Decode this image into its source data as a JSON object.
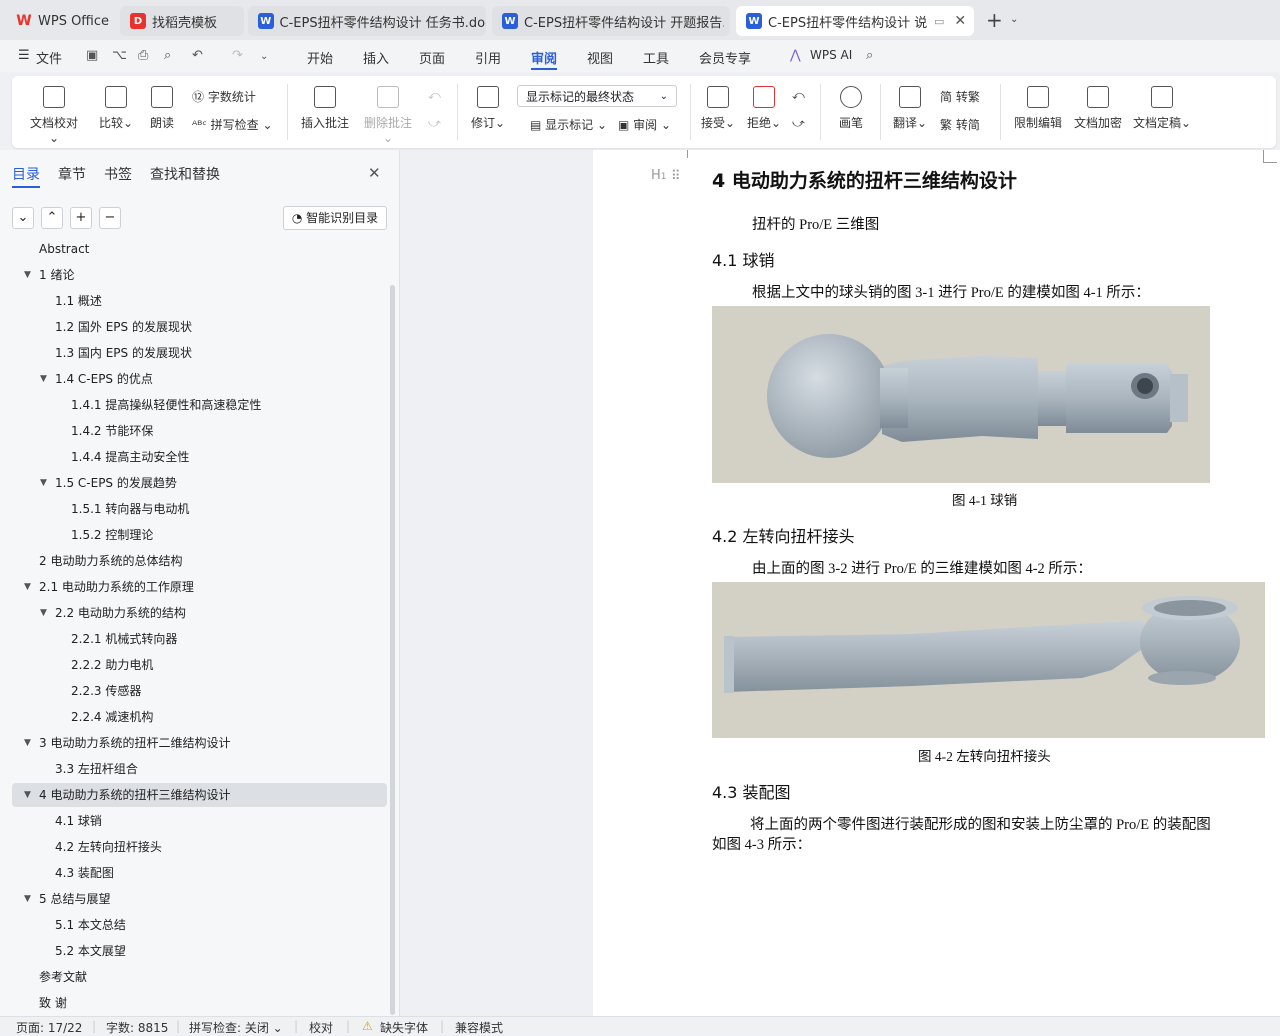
{
  "tabs": [
    {
      "label": "WPS Office",
      "icon": "wps-logo-icon",
      "color": "#e8322e"
    },
    {
      "label": "找稻壳模板",
      "icon": "docer-icon",
      "color": "#e8322e"
    },
    {
      "label": "C-EPS扭杆零件结构设计 任务书.doc",
      "icon": "word-doc-icon",
      "color": "#2b5fd9"
    },
    {
      "label": "C-EPS扭杆零件结构设计 开题报告.dc",
      "icon": "word-doc-icon",
      "color": "#2b5fd9"
    },
    {
      "label": "C-EPS扭杆零件结构设计 说明",
      "icon": "word-doc-icon",
      "color": "#2b5fd9"
    }
  ],
  "menu": {
    "file": "文件",
    "items": [
      "开始",
      "插入",
      "页面",
      "引用",
      "审阅",
      "视图",
      "工具",
      "会员专享"
    ],
    "active": "审阅",
    "wps_ai": "WPS AI"
  },
  "ribbon": {
    "proofread": "文档校对",
    "compare": "比较",
    "read": "朗读",
    "word_count": "字数统计",
    "spell_check": "拼写检查",
    "insert_comment": "插入批注",
    "delete_comment": "删除批注",
    "revise": "修订",
    "markup_state": "显示标记的最终状态",
    "show_markup": "显示标记",
    "review": "审阅",
    "accept": "接受",
    "reject": "拒绝",
    "pen": "画笔",
    "translate": "翻译",
    "to_traditional": "转繁",
    "to_simplified": "转简",
    "restrict_edit": "限制编辑",
    "encrypt": "文档加密",
    "finalize": "文档定稿"
  },
  "sidebar": {
    "tabs": [
      "目录",
      "章节",
      "书签",
      "查找和替换"
    ],
    "smart_toc": "智能识别目录",
    "toc": [
      {
        "text": "Abstract",
        "level": 0,
        "arrow": false
      },
      {
        "text": "1  绪论",
        "level": 0,
        "arrow": true
      },
      {
        "text": "1.1  概述",
        "level": 1,
        "arrow": false
      },
      {
        "text": "1.2  国外 EPS 的发展现状",
        "level": 1,
        "arrow": false
      },
      {
        "text": "1.3  国内 EPS 的发展现状",
        "level": 1,
        "arrow": false
      },
      {
        "text": "1.4    C-EPS 的优点",
        "level": 1,
        "arrow": true
      },
      {
        "text": "1.4.1  提高操纵轻便性和高速稳定性",
        "level": 2,
        "arrow": false
      },
      {
        "text": "1.4.2  节能环保",
        "level": 2,
        "arrow": false
      },
      {
        "text": "1.4.4  提高主动安全性",
        "level": 2,
        "arrow": false
      },
      {
        "text": "1.5    C-EPS 的发展趋势",
        "level": 1,
        "arrow": true
      },
      {
        "text": "1.5.1  转向器与电动机",
        "level": 2,
        "arrow": false
      },
      {
        "text": "1.5.2  控制理论",
        "level": 2,
        "arrow": false
      },
      {
        "text": "2  电动助力系统的总体结构",
        "level": 0,
        "arrow": false
      },
      {
        "text": "2.1  电动助力系统的工作原理",
        "level": 0,
        "arrow": true
      },
      {
        "text": "2.2  电动助力系统的结构",
        "level": 1,
        "arrow": true
      },
      {
        "text": "2.2.1  机械式转向器",
        "level": 2,
        "arrow": false
      },
      {
        "text": "2.2.2  助力电机",
        "level": 2,
        "arrow": false
      },
      {
        "text": "2.2.3  传感器",
        "level": 2,
        "arrow": false
      },
      {
        "text": "2.2.4  减速机构",
        "level": 2,
        "arrow": false
      },
      {
        "text": "3  电动助力系统的扭杆二维结构设计",
        "level": 0,
        "arrow": true
      },
      {
        "text": "3.3  左扭杆组合",
        "level": 1,
        "arrow": false
      },
      {
        "text": "4  电动助力系统的扭杆三维结构设计",
        "level": 0,
        "arrow": true
      },
      {
        "text": "4.1  球销",
        "level": 1,
        "arrow": false
      },
      {
        "text": "4.2  左转向扭杆接头",
        "level": 1,
        "arrow": false
      },
      {
        "text": "4.3  装配图",
        "level": 1,
        "arrow": false
      },
      {
        "text": "5  总结与展望",
        "level": 0,
        "arrow": true
      },
      {
        "text": "5.1  本文总结",
        "level": 1,
        "arrow": false
      },
      {
        "text": "5.2  本文展望",
        "level": 1,
        "arrow": false
      },
      {
        "text": "参考文献",
        "level": 0,
        "arrow": false
      },
      {
        "text": "致      谢",
        "level": 0,
        "arrow": false
      }
    ],
    "selected_index": 21
  },
  "document": {
    "heading_marker": "H",
    "h1": "4  电动助力系统的扭杆三维结构设计",
    "intro": "扭杆的 Pro/E 三维图",
    "s41": "4.1  球销",
    "p41": "根据上文中的球头销的图 3-1 进行 Pro/E 的建模如图 4-1 所示：",
    "cap41": "图 4-1  球销",
    "s42": "4.2  左转向扭杆接头",
    "p42": "由上面的图 3-2 进行 Pro/E 的三维建模如图 4-2 所示：",
    "cap42": "图 4-2  左转向扭杆接头",
    "s43": "4.3  装配图",
    "p43a": "将上面的两个零件图进行装配形成的图和安装上防尘罩的 Pro/E 的装配图",
    "p43b": "如图 4-3 所示："
  },
  "status": {
    "page": "页面: 17/22",
    "words": "字数: 8815",
    "spell": "拼写检查: 关闭",
    "proof": "校对",
    "missing_font": "缺失字体",
    "compat": "兼容模式"
  },
  "colors": {
    "accent": "#2b5fd9",
    "wps_red": "#e8322e",
    "figure_bg": "#d3d0c6",
    "part_metal": "#a9b4bd"
  }
}
